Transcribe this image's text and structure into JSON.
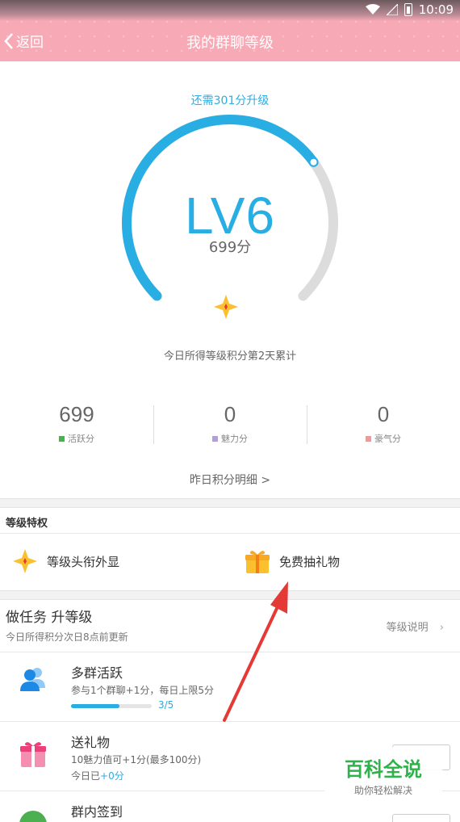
{
  "status": {
    "time": "10:09"
  },
  "header": {
    "back_label": "返回",
    "title": "我的群聊等级"
  },
  "gauge": {
    "hint": "还需301分升级",
    "level": "LV6",
    "points": "699分",
    "progress_fraction": 0.7,
    "accum_note": "今日所得等级积分第2天累计"
  },
  "stats": [
    {
      "value": "699",
      "label": "活跃分",
      "color": "#4caf50"
    },
    {
      "value": "0",
      "label": "魅力分",
      "color": "#b39ddb"
    },
    {
      "value": "0",
      "label": "豪气分",
      "color": "#ef9a9a"
    }
  ],
  "yesterday_link": "昨日积分明细 >",
  "privileges": {
    "title": "等级特权",
    "items": [
      {
        "label": "等级头衔外显",
        "icon": "star-icon"
      },
      {
        "label": "免费抽礼物",
        "icon": "gift-icon"
      }
    ]
  },
  "tasks": {
    "title": "做任务 升等级",
    "subtitle": "今日所得积分次日8点前更新",
    "rule_link": "等级说明",
    "items": [
      {
        "name": "多群活跃",
        "desc": "参与1个群聊+1分，每日上限5分",
        "progress": "3/5",
        "progress_fraction": 0.6
      },
      {
        "name": "送礼物",
        "desc": "10魅力值可+1分(最多100分)",
        "today_prefix": "今日已",
        "today_value": "+0分"
      },
      {
        "name": "群内签到"
      }
    ]
  },
  "watermark": {
    "title": "百科全说",
    "subtitle": "助你轻松解决"
  }
}
